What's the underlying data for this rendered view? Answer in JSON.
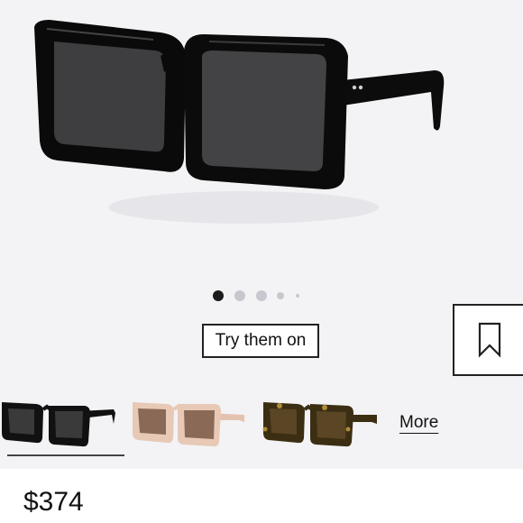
{
  "product": {
    "price": "$374"
  },
  "gallery": {
    "slide_count": 5,
    "active_slide": 1
  },
  "actions": {
    "try_on_label": "Try them on",
    "more_label": "More"
  },
  "thumbnails": [
    {
      "name": "black-variant",
      "frame_color": "#111111",
      "lens_color": "#3a3a3a"
    },
    {
      "name": "pink-variant",
      "frame_color": "#e7c9b6",
      "lens_color": "#8a6a57"
    },
    {
      "name": "tortoise-variant",
      "frame_color": "#3b2e12",
      "lens_color": "#5a4524"
    }
  ],
  "colors": {
    "background": "#f3f3f5",
    "accent": "#222222"
  }
}
